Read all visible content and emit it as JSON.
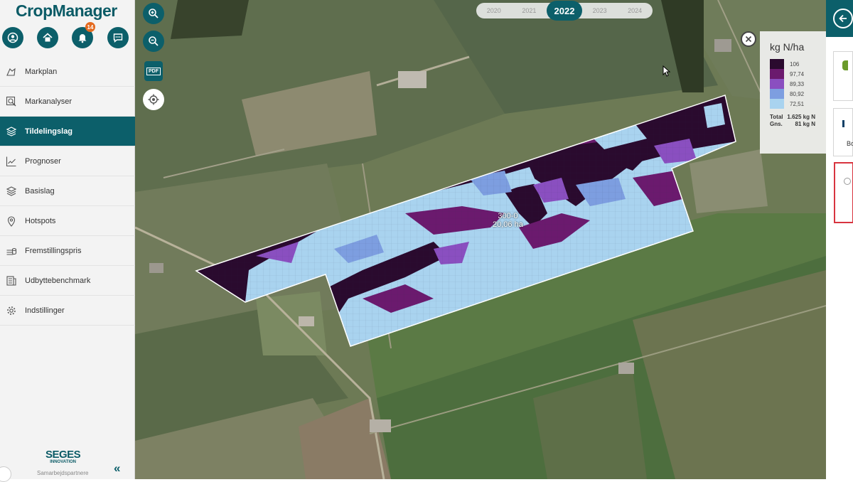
{
  "app": {
    "title": "CropManager"
  },
  "header_buttons": {
    "notification_count": "14"
  },
  "nav": {
    "items": [
      {
        "label": "Markplan",
        "icon": "hand-map-icon"
      },
      {
        "label": "Markanalyser",
        "icon": "magnify-icon"
      },
      {
        "label": "Tildelingslag",
        "icon": "layers-icon",
        "active": true
      },
      {
        "label": "Prognoser",
        "icon": "line-chart-icon"
      },
      {
        "label": "Basislag",
        "icon": "layers-outline-icon"
      },
      {
        "label": "Hotspots",
        "icon": "map-pin-icon"
      },
      {
        "label": "Fremstillingspris",
        "icon": "coins-icon"
      },
      {
        "label": "Udbyttebenchmark",
        "icon": "document-stack-icon"
      },
      {
        "label": "Indstillinger",
        "icon": "gear-icon"
      }
    ]
  },
  "footer": {
    "brand": "SEGES",
    "brand_sub": "INNOVATION",
    "partners": "Samarbejdspartnere",
    "collapse": "«"
  },
  "map_tools": {
    "zoom_in": "zoom-in-icon",
    "zoom_out": "zoom-out-icon",
    "pdf": "PDF",
    "locate": "locate-icon"
  },
  "years": {
    "items": [
      "2020",
      "2021",
      "2022",
      "2023",
      "2024"
    ],
    "selected": "2022"
  },
  "legend": {
    "title": "kg N/ha",
    "entries": [
      {
        "value": "106",
        "color": "#2a0a2e"
      },
      {
        "value": "97,74",
        "color": "#6b1a6e"
      },
      {
        "value": "89,33",
        "color": "#8a4fc0"
      },
      {
        "value": "80,92",
        "color": "#7d9ee0"
      },
      {
        "value": "72,51",
        "color": "#a9d3ef"
      }
    ],
    "total_label": "Total",
    "total_value": "1.625 kg N",
    "avg_label": "Gns.",
    "avg_value": "81 kg N"
  },
  "field": {
    "name": "300-0",
    "area": "20,06 ha"
  },
  "right_panel": {
    "card_text": "Bo"
  },
  "colors": {
    "brand": "#0c5f6a",
    "badge": "#e46a1f",
    "highlight": "#d8343f"
  }
}
